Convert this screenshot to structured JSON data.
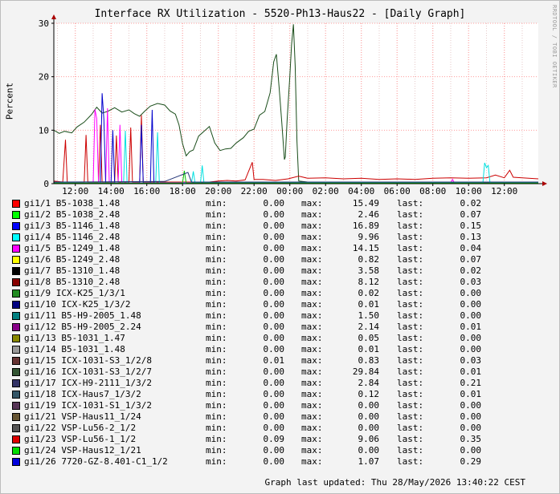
{
  "chart_data": {
    "type": "line",
    "title": "Interface RX Utilization - 5520-Ph13-Haus22 - [Daily Graph]",
    "ylabel": "Percent",
    "ylim": [
      0,
      30
    ],
    "yticks": [
      "0",
      "10",
      "20",
      "30"
    ],
    "xticks": [
      "12:00",
      "14:00",
      "16:00",
      "18:00",
      "20:00",
      "22:00",
      "00:00",
      "02:00",
      "04:00",
      "06:00",
      "08:00",
      "10:00",
      "12:00"
    ],
    "x_hours": [
      0,
      2,
      4,
      6,
      8,
      10,
      12,
      14,
      16,
      18,
      20,
      22,
      24
    ],
    "x_range_hours": [
      -1.2,
      25.9
    ],
    "grid": true,
    "series": [
      {
        "name": "gi1/16 ICX-1031-S3_1/2/7",
        "color": "#1a4d1a",
        "points": [
          [
            -1.2,
            10
          ],
          [
            -0.9,
            9.4
          ],
          [
            -0.6,
            9.8
          ],
          [
            -0.2,
            9.5
          ],
          [
            0.1,
            10.6
          ],
          [
            0.5,
            11.5
          ],
          [
            0.9,
            12.9
          ],
          [
            1.2,
            14.3
          ],
          [
            1.5,
            13.2
          ],
          [
            1.8,
            13.5
          ],
          [
            2.2,
            14.2
          ],
          [
            2.6,
            13.4
          ],
          [
            3.0,
            13.8
          ],
          [
            3.3,
            13.1
          ],
          [
            3.6,
            12.6
          ],
          [
            3.9,
            13.6
          ],
          [
            4.2,
            14.5
          ],
          [
            4.6,
            15.0
          ],
          [
            5.0,
            14.7
          ],
          [
            5.3,
            13.6
          ],
          [
            5.6,
            13.0
          ],
          [
            5.8,
            11.0
          ],
          [
            6.0,
            7.5
          ],
          [
            6.2,
            5.2
          ],
          [
            6.4,
            6.0
          ],
          [
            6.6,
            6.3
          ],
          [
            6.9,
            8.9
          ],
          [
            7.2,
            9.8
          ],
          [
            7.5,
            10.7
          ],
          [
            7.8,
            7.6
          ],
          [
            8.1,
            6.2
          ],
          [
            8.4,
            6.5
          ],
          [
            8.7,
            6.6
          ],
          [
            9.0,
            7.6
          ],
          [
            9.4,
            8.6
          ],
          [
            9.7,
            9.8
          ],
          [
            10.0,
            10.2
          ],
          [
            10.3,
            12.8
          ],
          [
            10.6,
            13.5
          ],
          [
            10.9,
            17.0
          ],
          [
            11.1,
            22.8
          ],
          [
            11.25,
            24.2
          ],
          [
            11.4,
            18.0
          ],
          [
            11.55,
            11.5
          ],
          [
            11.7,
            4.5
          ],
          [
            11.75,
            5.0
          ],
          [
            11.85,
            12.0
          ],
          [
            12.0,
            20.0
          ],
          [
            12.1,
            26.0
          ],
          [
            12.2,
            29.8
          ],
          [
            12.3,
            22.0
          ],
          [
            12.4,
            8.0
          ],
          [
            12.5,
            0.5
          ],
          [
            13.0,
            0.3
          ],
          [
            15.0,
            0.2
          ],
          [
            20.0,
            0.2
          ],
          [
            24.0,
            0.2
          ],
          [
            25.9,
            0.2
          ]
        ]
      },
      {
        "name": "gi1/23 VSP-Lu56-1_1/2",
        "color": "#cc0000",
        "points": [
          [
            -1.2,
            0.5
          ],
          [
            -0.7,
            0.3
          ],
          [
            -0.55,
            8.2
          ],
          [
            -0.45,
            0.3
          ],
          [
            0.5,
            0.3
          ],
          [
            0.6,
            9.1
          ],
          [
            0.7,
            0.3
          ],
          [
            1.3,
            0.3
          ],
          [
            1.4,
            11.0
          ],
          [
            1.5,
            0.3
          ],
          [
            2.2,
            0.3
          ],
          [
            2.3,
            9.0
          ],
          [
            2.4,
            0.3
          ],
          [
            3.0,
            0.3
          ],
          [
            3.1,
            10.5
          ],
          [
            3.2,
            0.3
          ],
          [
            3.6,
            0.3
          ],
          [
            3.7,
            12.8
          ],
          [
            3.8,
            0.3
          ],
          [
            7.5,
            0.3
          ],
          [
            8.0,
            0.5
          ],
          [
            8.5,
            0.6
          ],
          [
            9.0,
            0.5
          ],
          [
            9.5,
            0.7
          ],
          [
            9.9,
            4.0
          ],
          [
            10.0,
            0.8
          ],
          [
            10.5,
            0.8
          ],
          [
            11.2,
            0.6
          ],
          [
            11.9,
            0.9
          ],
          [
            12.5,
            1.4
          ],
          [
            13.0,
            1.0
          ],
          [
            14.0,
            1.1
          ],
          [
            15.0,
            0.9
          ],
          [
            16.0,
            1.0
          ],
          [
            17.0,
            0.8
          ],
          [
            18.0,
            0.9
          ],
          [
            19.0,
            0.8
          ],
          [
            20.0,
            1.0
          ],
          [
            21.0,
            1.1
          ],
          [
            22.0,
            1.0
          ],
          [
            23.0,
            1.1
          ],
          [
            23.5,
            1.6
          ],
          [
            24.0,
            1.1
          ],
          [
            24.3,
            2.5
          ],
          [
            24.5,
            1.2
          ],
          [
            25.0,
            1.1
          ],
          [
            25.9,
            0.9
          ]
        ]
      },
      {
        "name": "gi1/5 B5-1249_1.48",
        "color": "#ff00ff",
        "points": [
          [
            -1.2,
            0.2
          ],
          [
            1.0,
            0.2
          ],
          [
            1.1,
            13.9
          ],
          [
            1.2,
            12.2
          ],
          [
            1.3,
            0.2
          ],
          [
            1.7,
            0.2
          ],
          [
            1.8,
            14.1
          ],
          [
            1.9,
            0.2
          ],
          [
            2.4,
            0.2
          ],
          [
            2.5,
            11.0
          ],
          [
            2.6,
            0.2
          ],
          [
            7.0,
            0.2
          ],
          [
            21.0,
            0.2
          ],
          [
            21.1,
            0.8
          ],
          [
            21.2,
            0.2
          ],
          [
            25.9,
            0.2
          ]
        ]
      },
      {
        "name": "gi1/3 B5-1146_1.48",
        "color": "#0000cc",
        "points": [
          [
            -1.2,
            0.1
          ],
          [
            1.4,
            0.1
          ],
          [
            1.5,
            16.9
          ],
          [
            1.6,
            12.0
          ],
          [
            1.7,
            0.1
          ],
          [
            2.0,
            0.1
          ],
          [
            2.1,
            10.0
          ],
          [
            2.2,
            0.1
          ],
          [
            3.6,
            0.1
          ],
          [
            3.7,
            11.0
          ],
          [
            3.8,
            0.1
          ],
          [
            4.2,
            0.1
          ],
          [
            4.3,
            13.8
          ],
          [
            4.4,
            0.1
          ],
          [
            25.9,
            0.1
          ]
        ]
      },
      {
        "name": "gi1/4 B5-1146_2.48",
        "color": "#00e0e0",
        "points": [
          [
            -1.2,
            0.1
          ],
          [
            2.7,
            0.1
          ],
          [
            2.8,
            9.9
          ],
          [
            2.9,
            0.1
          ],
          [
            4.5,
            0.1
          ],
          [
            4.6,
            9.6
          ],
          [
            4.7,
            0.1
          ],
          [
            6.5,
            0.1
          ],
          [
            6.6,
            2.3
          ],
          [
            6.7,
            0.1
          ],
          [
            7.0,
            0.1
          ],
          [
            7.1,
            3.4
          ],
          [
            7.2,
            0.1
          ],
          [
            22.8,
            0.1
          ],
          [
            22.9,
            3.9
          ],
          [
            23.0,
            3.0
          ],
          [
            23.1,
            3.4
          ],
          [
            23.2,
            0.1
          ],
          [
            25.9,
            0.1
          ]
        ]
      },
      {
        "name": "gi1/2 B5-1038_2.48",
        "color": "#00c000",
        "points": [
          [
            -1.2,
            0.1
          ],
          [
            6.0,
            0.1
          ],
          [
            6.1,
            2.4
          ],
          [
            6.2,
            0.1
          ],
          [
            25.9,
            0.1
          ]
        ]
      },
      {
        "name": "gi1/17 ICX-H9-2111_1/3/2",
        "color": "#223377",
        "points": [
          [
            -1.2,
            0.3
          ],
          [
            5.0,
            0.4
          ],
          [
            6.3,
            2.1
          ],
          [
            6.5,
            0.3
          ],
          [
            25.9,
            0.3
          ]
        ]
      }
    ]
  },
  "legend": [
    {
      "color": "#ff0000",
      "name": "gi1/1 B5-1038_1.48",
      "min": "0.00",
      "max": "15.49",
      "last": "0.02"
    },
    {
      "color": "#00ff00",
      "name": "gi1/2 B5-1038_2.48",
      "min": "0.00",
      "max": "2.46",
      "last": "0.07"
    },
    {
      "color": "#0000ff",
      "name": "gi1/3 B5-1146_1.48",
      "min": "0.00",
      "max": "16.89",
      "last": "0.15"
    },
    {
      "color": "#00ffff",
      "name": "gi1/4 B5-1146_2.48",
      "min": "0.00",
      "max": "9.96",
      "last": "0.13"
    },
    {
      "color": "#ff00ff",
      "name": "gi1/5 B5-1249_1.48",
      "min": "0.00",
      "max": "14.15",
      "last": "0.04"
    },
    {
      "color": "#ffff00",
      "name": "gi1/6 B5-1249_2.48",
      "min": "0.00",
      "max": "0.82",
      "last": "0.07"
    },
    {
      "color": "#000000",
      "name": "gi1/7 B5-1310_1.48",
      "min": "0.00",
      "max": "3.58",
      "last": "0.02"
    },
    {
      "color": "#880000",
      "name": "gi1/8 B5-1310_2.48",
      "min": "0.00",
      "max": "8.12",
      "last": "0.03"
    },
    {
      "color": "#228b22",
      "name": "gi1/9 ICX-K25_1/3/1",
      "min": "0.00",
      "max": "0.02",
      "last": "0.00"
    },
    {
      "color": "#000080",
      "name": "gi1/10 ICX-K25_1/3/2",
      "min": "0.00",
      "max": "0.01",
      "last": "0.00"
    },
    {
      "color": "#008080",
      "name": "gi1/11 B5-H9-2005_1.48",
      "min": "0.00",
      "max": "1.50",
      "last": "0.00"
    },
    {
      "color": "#880088",
      "name": "gi1/12 B5-H9-2005_2.24",
      "min": "0.00",
      "max": "2.14",
      "last": "0.01"
    },
    {
      "color": "#888800",
      "name": "gi1/13 B5-1031_1.47",
      "min": "0.00",
      "max": "0.05",
      "last": "0.00"
    },
    {
      "color": "#999999",
      "name": "gi1/14 B5-1031_1.48",
      "min": "0.00",
      "max": "0.01",
      "last": "0.00"
    },
    {
      "color": "#663333",
      "name": "gi1/15 ICX-1031-S3_1/2/8",
      "min": "0.01",
      "max": "0.83",
      "last": "0.03"
    },
    {
      "color": "#335533",
      "name": "gi1/16 ICX-1031-S3_1/2/7",
      "min": "0.00",
      "max": "29.84",
      "last": "0.01"
    },
    {
      "color": "#333366",
      "name": "gi1/17 ICX-H9-2111_1/3/2",
      "min": "0.00",
      "max": "2.84",
      "last": "0.21"
    },
    {
      "color": "#335566",
      "name": "gi1/18 ICX-Haus7_1/3/2",
      "min": "0.00",
      "max": "0.12",
      "last": "0.01"
    },
    {
      "color": "#553355",
      "name": "gi1/19 ICX-1031-S1_1/3/2",
      "min": "0.00",
      "max": "0.00",
      "last": "0.00"
    },
    {
      "color": "#665533",
      "name": "gi1/21 VSP-Haus11_1/24",
      "min": "0.00",
      "max": "0.00",
      "last": "0.00"
    },
    {
      "color": "#555555",
      "name": "gi1/22 VSP-Lu56-2_1/2",
      "min": "0.00",
      "max": "0.00",
      "last": "0.00"
    },
    {
      "color": "#dd0000",
      "name": "gi1/23 VSP-Lu56-1_1/2",
      "min": "0.09",
      "max": "9.06",
      "last": "0.35"
    },
    {
      "color": "#00dd00",
      "name": "gi1/24 VSP-Haus12_1/21",
      "min": "0.00",
      "max": "0.00",
      "last": "0.00"
    },
    {
      "color": "#0000dd",
      "name": "gi1/26 7720-GZ-8.401-C1_1/2",
      "min": "0.00",
      "max": "1.07",
      "last": "0.29"
    }
  ],
  "labels": {
    "min": "min:",
    "max": "max:",
    "last": "last:"
  },
  "footer": "Graph last updated: Thu 28/May/2026 13:40:22 CEST",
  "watermark": "RRDTOOL / TOBI OETIKER"
}
